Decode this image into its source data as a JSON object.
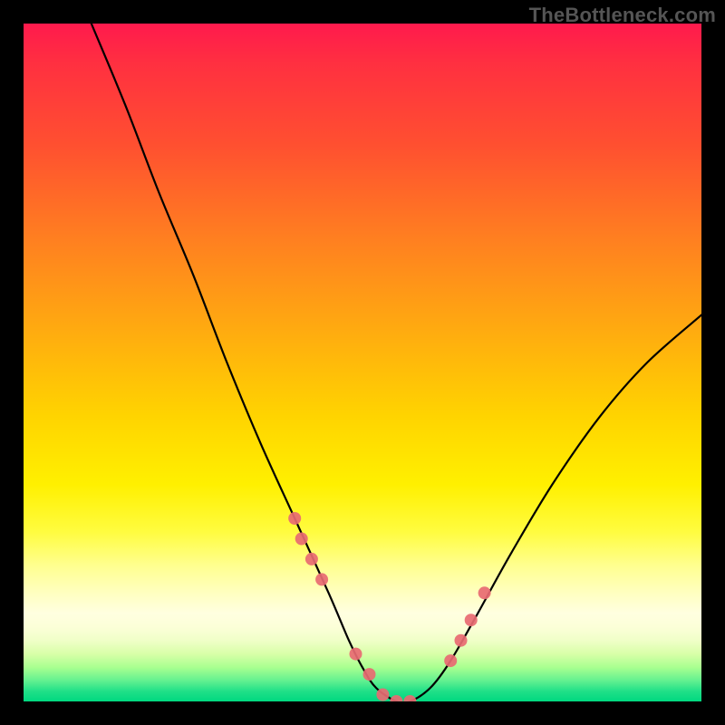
{
  "watermark": "TheBottleneck.com",
  "chart_data": {
    "type": "line",
    "title": "",
    "xlabel": "",
    "ylabel": "",
    "xlim": [
      0,
      100
    ],
    "ylim": [
      0,
      100
    ],
    "series": [
      {
        "name": "bottleneck-curve",
        "x": [
          10,
          15,
          20,
          25,
          30,
          35,
          40,
          45,
          48,
          50,
          52,
          55,
          57,
          60,
          63,
          67,
          72,
          78,
          85,
          92,
          100
        ],
        "values": [
          100,
          88,
          75,
          63,
          50,
          38,
          27,
          16,
          9,
          5,
          2,
          0,
          0,
          2,
          6,
          13,
          22,
          32,
          42,
          50,
          57
        ]
      }
    ],
    "markers": {
      "name": "highlight-dots",
      "x": [
        40,
        41,
        42.5,
        44,
        49,
        51,
        53,
        55,
        57,
        63,
        64.5,
        66,
        68
      ],
      "values": [
        27,
        24,
        21,
        18,
        7,
        4,
        1,
        0,
        0,
        6,
        9,
        12,
        16
      ],
      "color": "#e86a72",
      "radius": 7
    },
    "background": "rainbow-vertical-gradient"
  }
}
